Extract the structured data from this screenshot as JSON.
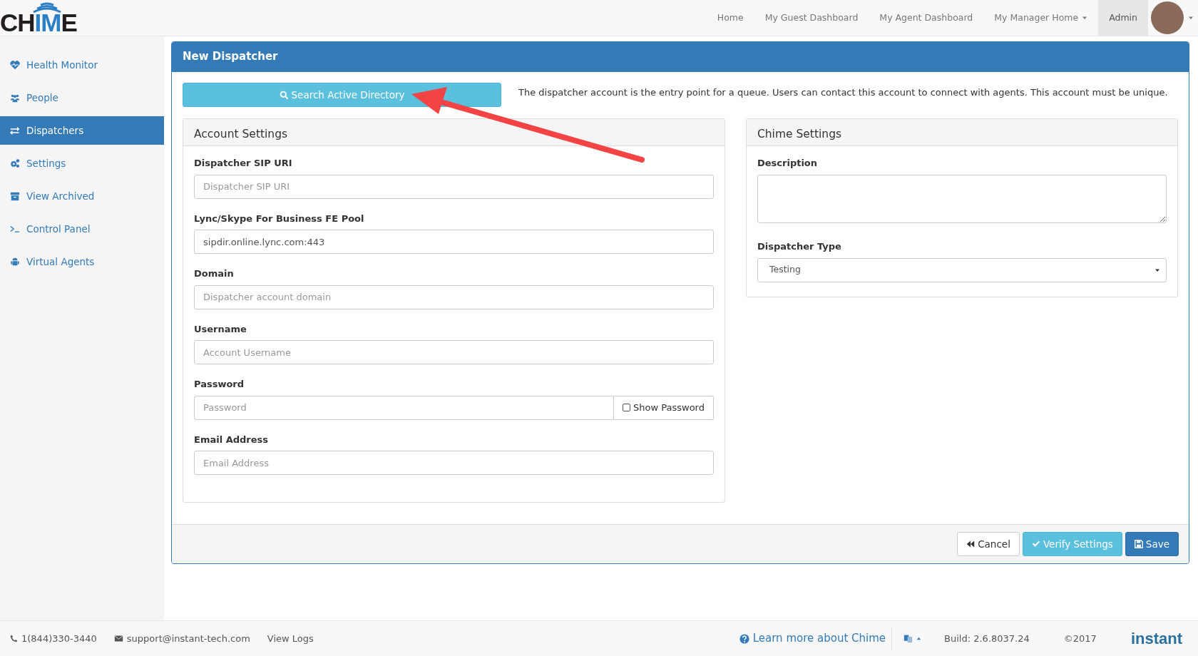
{
  "logo": {
    "parts": [
      {
        "text": "CH",
        "accent": false
      },
      {
        "text": "IM",
        "accent": true
      },
      {
        "text": "E",
        "accent": false
      }
    ]
  },
  "nav": [
    {
      "label": "Home",
      "selected": false,
      "dropdown": false
    },
    {
      "label": "My Guest Dashboard",
      "selected": false,
      "dropdown": false
    },
    {
      "label": "My Agent Dashboard",
      "selected": false,
      "dropdown": false
    },
    {
      "label": "My Manager Home",
      "selected": false,
      "dropdown": true
    },
    {
      "label": "Admin",
      "selected": true,
      "dropdown": false
    }
  ],
  "sidebar": {
    "items": [
      {
        "label": "Health Monitor",
        "kind": "heart",
        "selected": false
      },
      {
        "label": "People",
        "kind": "people",
        "selected": false
      },
      {
        "label": "Dispatchers",
        "kind": "arrows",
        "selected": true
      },
      {
        "label": "Settings",
        "kind": "gears",
        "selected": false
      },
      {
        "label": "View Archived",
        "kind": "archive",
        "selected": false
      },
      {
        "label": "Control Panel",
        "kind": "terminal",
        "selected": false
      },
      {
        "label": "Virtual Agents",
        "kind": "robot",
        "selected": false
      }
    ]
  },
  "panel": {
    "title": "New Dispatcher",
    "search_button": "Search Active Directory",
    "intro": "The dispatcher account is the entry point for a queue. Users can contact this account to connect with agents. This account must be unique.",
    "account_settings": {
      "title": "Account Settings",
      "fields": [
        {
          "kind": "text",
          "label": "Dispatcher SIP URI",
          "placeholder": "Dispatcher SIP URI"
        },
        {
          "kind": "text",
          "label": "Lync/Skype For Business FE Pool",
          "value": "sipdir.online.lync.com:443"
        },
        {
          "kind": "text",
          "label": "Domain",
          "placeholder": "Dispatcher account domain"
        },
        {
          "kind": "text",
          "label": "Username",
          "placeholder": "Account Username"
        },
        {
          "kind": "password",
          "label": "Password",
          "placeholder": "Password",
          "toggle": {
            "label": "Show Password",
            "checked": false
          }
        },
        {
          "kind": "text",
          "label": "Email Address",
          "placeholder": "Email Address"
        }
      ]
    },
    "chime_settings": {
      "title": "Chime Settings",
      "fields": [
        {
          "kind": "textarea",
          "label": "Description"
        },
        {
          "kind": "select",
          "label": "Dispatcher Type",
          "value": "Testing"
        }
      ]
    },
    "buttons": [
      {
        "kind": "cancel",
        "label": "Cancel"
      },
      {
        "kind": "verify",
        "label": "Verify Settings"
      },
      {
        "kind": "save",
        "label": "Save"
      }
    ]
  },
  "footer": {
    "phone": "1(844)330-3440",
    "email": "support@instant-tech.com",
    "logs": "View Logs",
    "learn_more": "Learn more about Chime",
    "build": "Build: 2.6.8037.24",
    "copyright": "©2017",
    "brand": "instant"
  }
}
